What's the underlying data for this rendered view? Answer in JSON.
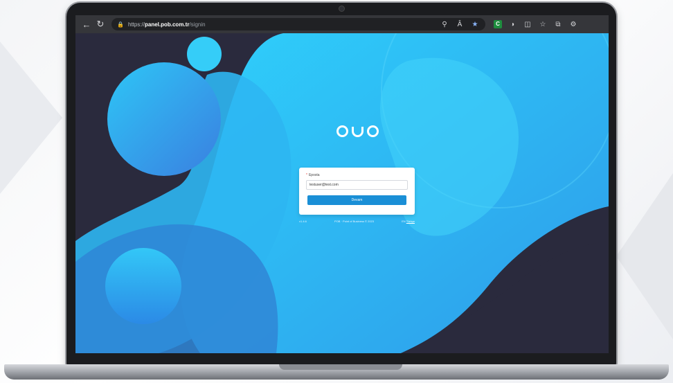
{
  "browser": {
    "url_scheme": "https://",
    "url_host": "panel.pob.com.tr",
    "url_path": "/signin"
  },
  "login": {
    "email_label": "Eposta",
    "email_value": "testuser@test.com",
    "submit_label": "Devam"
  },
  "footer": {
    "version": "v1.4.6",
    "copyright": "POB · Point of Business © 2023",
    "lang_code": "EN",
    "lang_link": "Türkçe"
  },
  "colors": {
    "accent": "#1a8fd6",
    "screen_bg": "#2a2a3d",
    "blob_cyan": "#2ec4f7",
    "blob_blue": "#3aa6ee"
  }
}
